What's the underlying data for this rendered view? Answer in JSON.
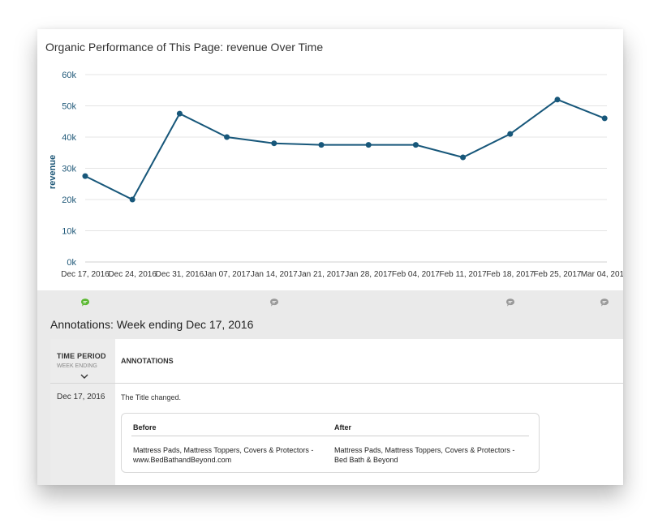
{
  "chart": {
    "title": "Organic Performance of This Page: revenue Over Time"
  },
  "chart_data": {
    "type": "line",
    "title": "Organic Performance of This Page: revenue Over Time",
    "xlabel": "",
    "ylabel": "revenue",
    "ylim": [
      0,
      60000
    ],
    "y_ticks": [
      "0k",
      "10k",
      "20k",
      "30k",
      "40k",
      "50k",
      "60k"
    ],
    "grid": true,
    "categories": [
      "Dec 17, 2016",
      "Dec 24, 2016",
      "Dec 31, 2016",
      "Jan 07, 2017",
      "Jan 14, 2017",
      "Jan 21, 2017",
      "Jan 28, 2017",
      "Feb 04, 2017",
      "Feb 11, 2017",
      "Feb 18, 2017",
      "Feb 25, 2017",
      "Mar 04, 2017"
    ],
    "series": [
      {
        "values": [
          27500,
          20000,
          47500,
          40000,
          38000,
          37500,
          37500,
          37500,
          33500,
          41000,
          52000,
          46000
        ]
      }
    ],
    "line_color": "#17577a"
  },
  "annotations": {
    "marker_icon": "speech-bubble-icon",
    "marker_active_color": "#5bb832",
    "marker_color": "#999999",
    "heading": "Annotations: Week ending Dec 17, 2016",
    "col_time": "TIME PERIOD",
    "col_time_sub": "WEEK ENDING",
    "col_annotations": "ANNOTATIONS",
    "row": {
      "date": "Dec 17, 2016",
      "text": "The Title changed.",
      "before_label": "Before",
      "after_label": "After",
      "before_line1": "Mattress Pads, Mattress Toppers, Covers & Protectors -",
      "before_line2": "www.BedBathandBeyond.com",
      "after_line1": "Mattress Pads, Mattress Toppers, Covers & Protectors -",
      "after_line2": "Bed Bath & Beyond"
    }
  }
}
